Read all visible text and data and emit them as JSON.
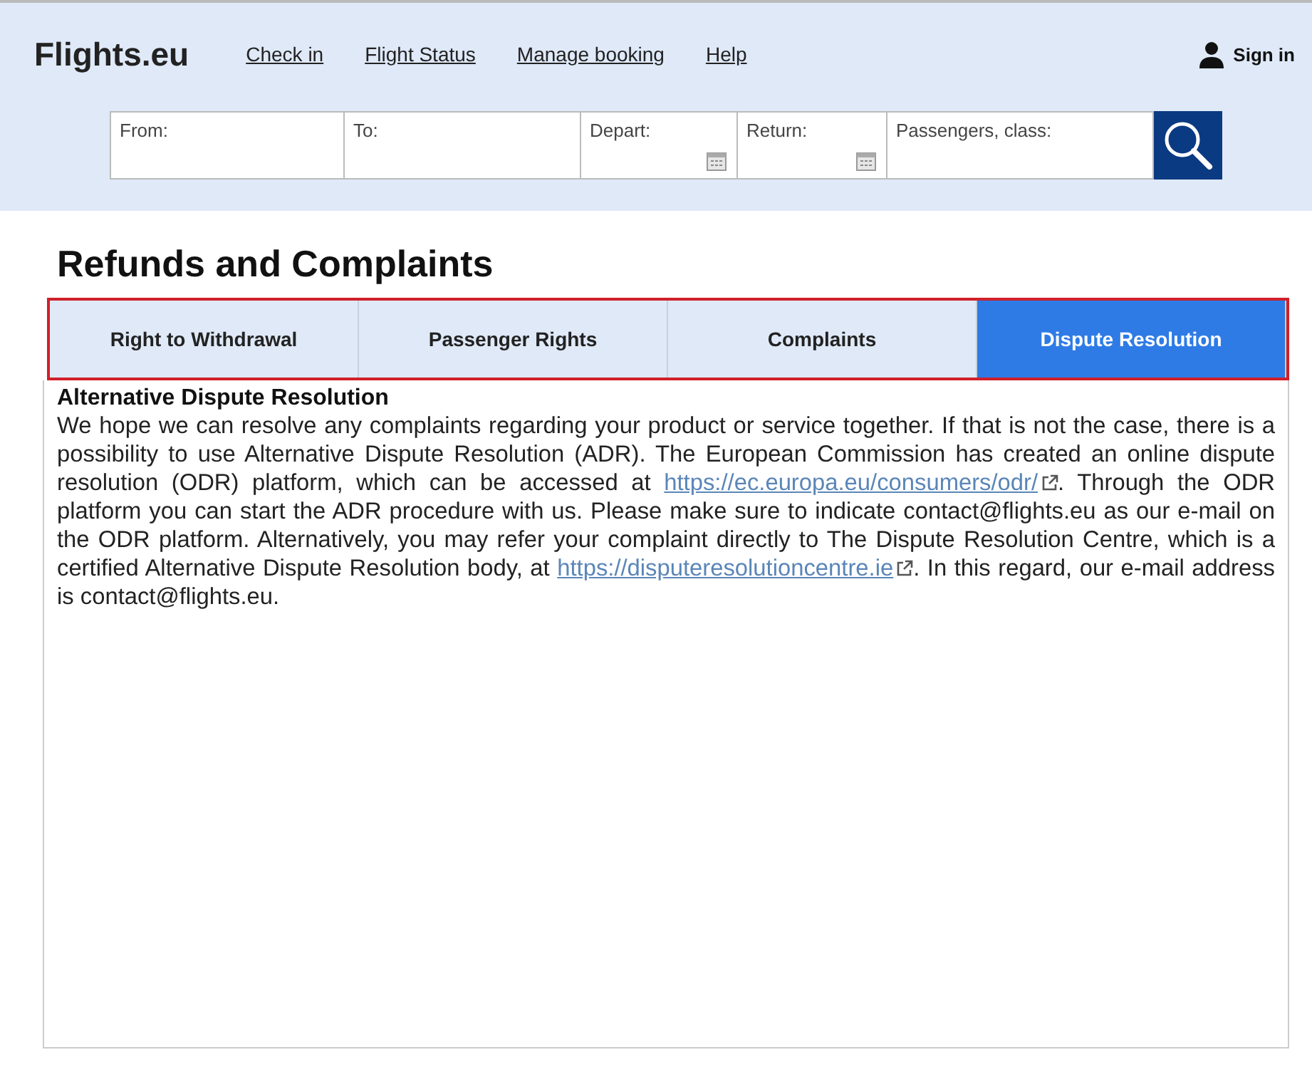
{
  "header": {
    "logo": "Flights.eu",
    "nav": [
      "Check in",
      "Flight Status",
      "Manage booking",
      "Help"
    ],
    "sign_in": "Sign in"
  },
  "search_form": {
    "fields": [
      {
        "kind": "text",
        "placeholder": "From:"
      },
      {
        "kind": "text",
        "placeholder": "To:"
      },
      {
        "kind": "date",
        "placeholder": "Depart:"
      },
      {
        "kind": "date",
        "placeholder": "Return:"
      },
      {
        "kind": "text",
        "placeholder": "Passengers, class:"
      }
    ]
  },
  "page_title": "Refunds and Complaints",
  "tabs_highlighted": true,
  "tabs": [
    {
      "label": "Right to Withdrawal",
      "selected": false
    },
    {
      "label": "Passenger Rights",
      "selected": false
    },
    {
      "label": "Complaints",
      "selected": false
    },
    {
      "label": "Dispute Resolution",
      "selected": true
    }
  ],
  "content": {
    "heading": "Alternative Dispute Resolution",
    "paragraph": [
      {
        "kind": "text",
        "text": "We hope we can resolve any complaints regarding your product or service together. If that is not the case, there is a possibility to use Alternative Dispute Resolution (ADR). The European Commission has created an online dispute resolution (ODR) platform, which can be accessed at "
      },
      {
        "kind": "link",
        "text": "https://ec.europa.eu/consumers/odr/"
      },
      {
        "kind": "text",
        "text": ". Through the ODR platform you can start the ADR procedure with us. Please make sure to indicate contact@flights.eu as our e-mail on the ODR platform. Alternatively, you may refer your complaint directly to The Dispute Resolution Centre, which is a certified Alternative Dispute Resolution body, at "
      },
      {
        "kind": "link",
        "text": "https://disputeresolutioncentre.ie"
      },
      {
        "kind": "text",
        "text": ". In this regard, our e-mail address is contact@flights.eu."
      }
    ]
  }
}
